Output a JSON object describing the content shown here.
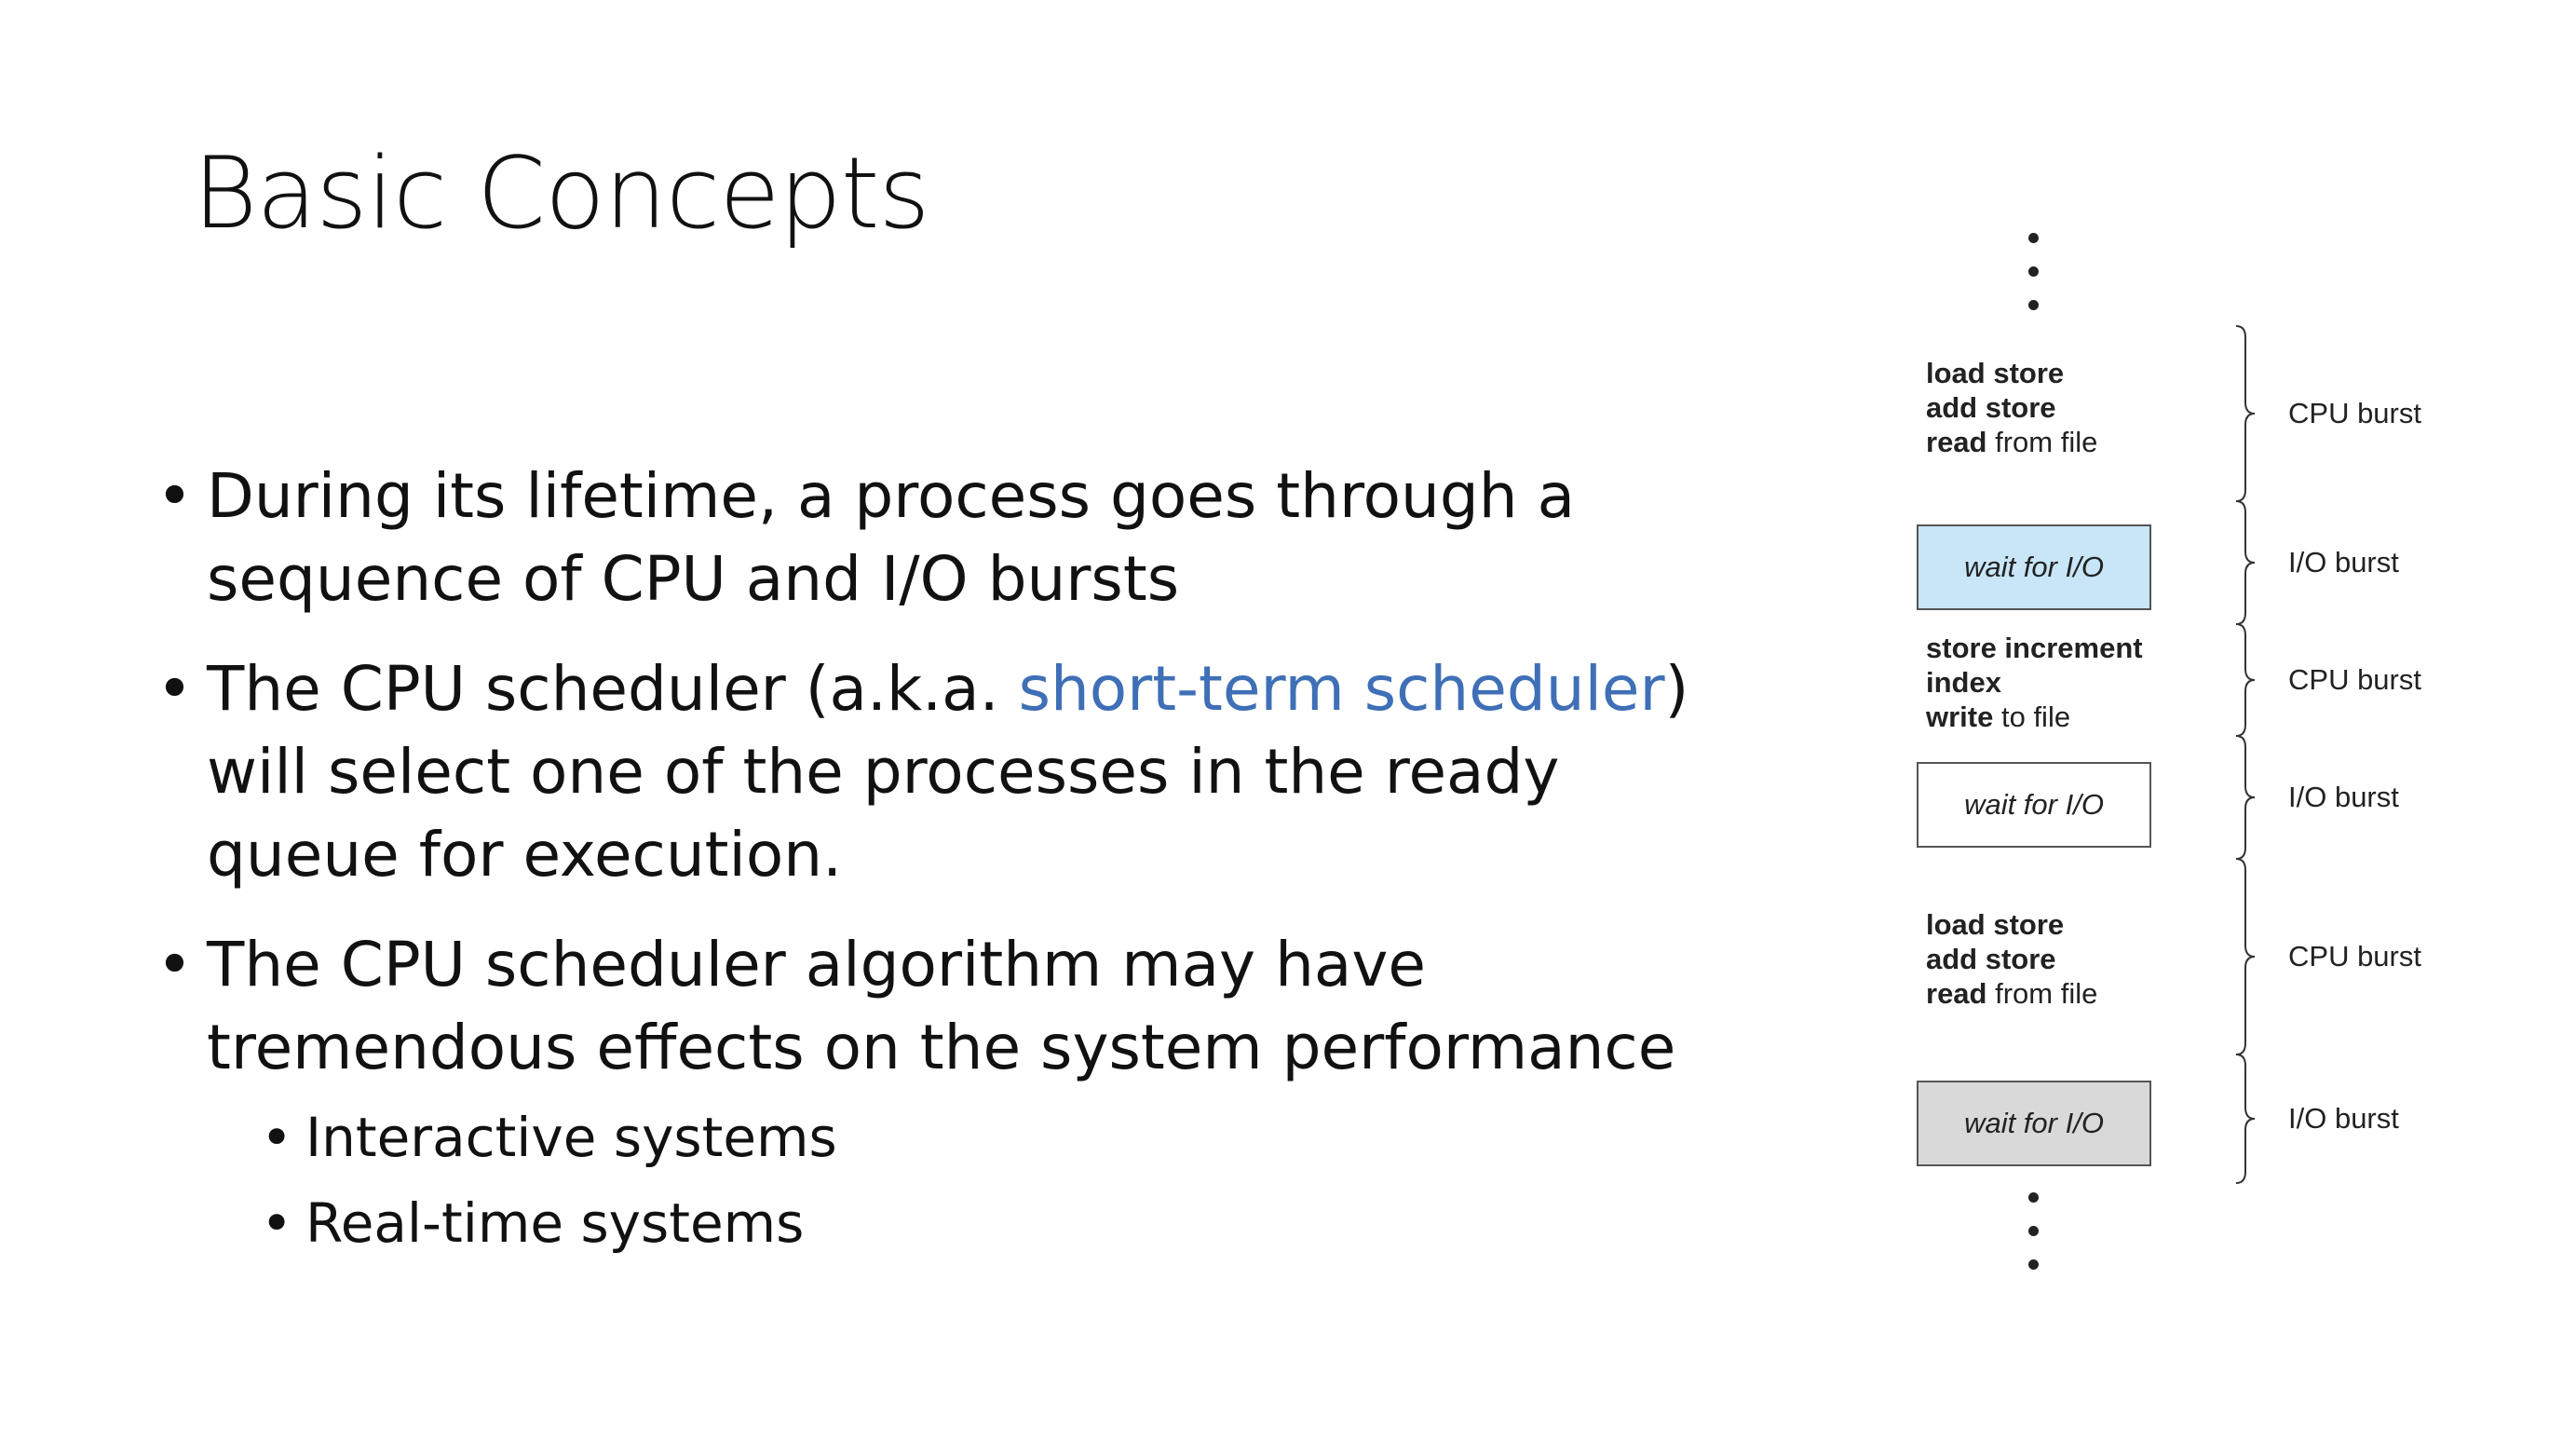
{
  "slide": {
    "title": "Basic Concepts",
    "bullets": [
      {
        "parts": [
          "During its lifetime, a process goes through a sequence of CPU and I/O bursts"
        ]
      },
      {
        "parts": [
          "The CPU scheduler (a.k.a. ",
          "short-term scheduler",
          ") will select one of the processes in the ready queue for execution."
        ]
      },
      {
        "parts": [
          "The CPU scheduler algorithm may have tremendous effects on the system performance"
        ],
        "subitems": [
          "Interactive systems",
          "Real-time systems"
        ]
      }
    ]
  },
  "diagram": {
    "blocks": [
      {
        "kind": "cpu",
        "lines": [
          [
            {
              "b": "load store"
            }
          ],
          [
            {
              "b": "add store"
            }
          ],
          [
            {
              "b": "read"
            },
            {
              "t": " from file"
            }
          ]
        ],
        "label": "CPU burst"
      },
      {
        "kind": "io",
        "text": "wait for I/O",
        "fill": "#C8E6F8",
        "label": "I/O burst"
      },
      {
        "kind": "cpu",
        "lines": [
          [
            {
              "b": "store increment"
            }
          ],
          [
            {
              "b": "index"
            }
          ],
          [
            {
              "b": "write"
            },
            {
              "t": " to file"
            }
          ]
        ],
        "label": "CPU burst"
      },
      {
        "kind": "io",
        "text": "wait for I/O",
        "fill": "#FFFFFF",
        "label": "I/O burst"
      },
      {
        "kind": "cpu",
        "lines": [
          [
            {
              "b": "load store"
            }
          ],
          [
            {
              "b": "add store"
            }
          ],
          [
            {
              "b": "read"
            },
            {
              "t": " from file"
            }
          ]
        ],
        "label": "CPU burst"
      },
      {
        "kind": "io",
        "text": "wait for I/O",
        "fill": "#D9D9D9",
        "label": "I/O burst"
      }
    ]
  },
  "colors": {
    "accent": "#3F6FB6",
    "text": "#111111"
  }
}
